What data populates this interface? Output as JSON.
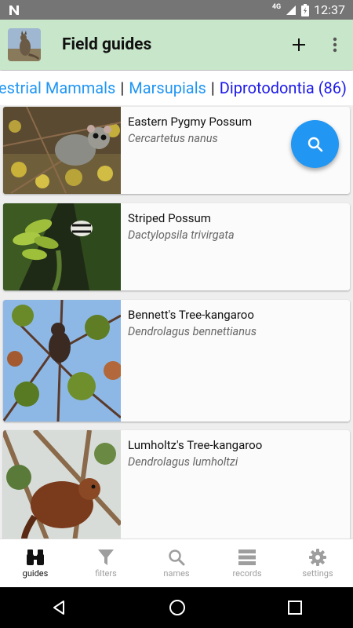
{
  "status_bar": {
    "network": "4G",
    "time": "12:37"
  },
  "app_bar": {
    "title": "Field guides"
  },
  "breadcrumb": {
    "items": [
      "restrial Mammals",
      "Marsupials",
      "Diprotodontia (86)"
    ],
    "separator": "|"
  },
  "species": [
    {
      "common_name": "Eastern Pygmy Possum",
      "scientific_name": "Cercartetus nanus"
    },
    {
      "common_name": "Striped Possum",
      "scientific_name": "Dactylopsila trivirgata"
    },
    {
      "common_name": "Bennett's Tree-kangaroo",
      "scientific_name": "Dendrolagus bennettianus"
    },
    {
      "common_name": "Lumholtz's Tree-kangaroo",
      "scientific_name": "Dendrolagus lumholtzi"
    }
  ],
  "bottom_nav": {
    "items": [
      {
        "label": "guides",
        "icon": "binoculars-icon",
        "active": true
      },
      {
        "label": "filters",
        "icon": "filter-icon",
        "active": false
      },
      {
        "label": "names",
        "icon": "search-icon",
        "active": false
      },
      {
        "label": "records",
        "icon": "list-icon",
        "active": false
      },
      {
        "label": "settings",
        "icon": "gear-icon",
        "active": false
      }
    ]
  },
  "colors": {
    "app_bar": "#c8e6c9",
    "accent": "#2196f3",
    "breadcrumb_current": "#1d1ae8"
  }
}
